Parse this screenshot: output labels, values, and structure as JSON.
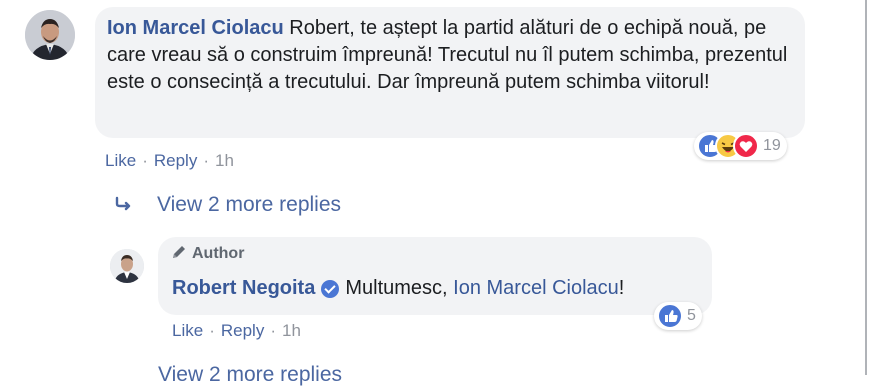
{
  "comment": {
    "author": "Ion Marcel Ciolacu",
    "text": "Robert, te aștept la partid alături de o echipă nouă, pe care vreau să o construim împreună! Trecutul nu îl putem schimba, prezentul este o consecință a trecutului. Dar împreună putem schimba viitorul!",
    "like_label": "Like",
    "reply_label": "Reply",
    "time": "1h",
    "reaction_count": "19",
    "reactions": [
      "like-icon",
      "haha-icon",
      "love-icon"
    ]
  },
  "view_more": {
    "label": "View 2 more replies"
  },
  "reply": {
    "badge": "Author",
    "author": "Robert Negoita",
    "mention": "Ion Marcel Ciolacu",
    "text_prefix": "Multumesc, ",
    "text_suffix": "!",
    "like_label": "Like",
    "reply_label": "Reply",
    "time": "1h",
    "reaction_count": "5",
    "reactions": [
      "like-icon"
    ]
  },
  "cut_off": {
    "label": "View 2 more replies"
  },
  "colors": {
    "link": "#385898",
    "bubble": "#f2f3f5",
    "like_blue": "#4a76d4",
    "love_red": "#f0284a",
    "haha_yellow": "#f7c944"
  }
}
